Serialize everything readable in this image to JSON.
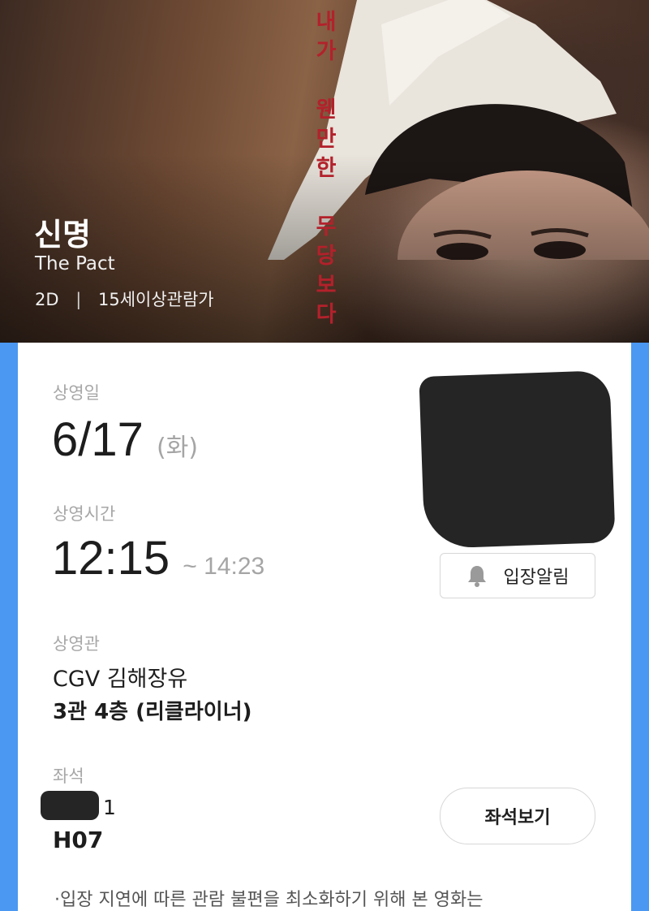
{
  "movie": {
    "title": "신명",
    "subtitle": "The Pact",
    "format": "2D",
    "separator": "|",
    "rating": "15세이상관람가",
    "poster_text": [
      "내",
      "가",
      "",
      "웬",
      "만",
      "한",
      "",
      "무",
      "당",
      "보",
      "다"
    ]
  },
  "ticket": {
    "date_label": "상영일",
    "date": "6/17",
    "weekday": "(화)",
    "time_label": "상영시간",
    "start_time": "12:15",
    "end_time": "~ 14:23",
    "theater_label": "상영관",
    "theater_name": "CGV 김해장유",
    "hall": "3관 4층 (리클라이너)",
    "seat_label": "좌석",
    "seat_suffix": "1",
    "seat_code": "H07",
    "notice": "·입장 지연에 따른 관람 불편을 최소화하기 위해 본 영화는"
  },
  "buttons": {
    "entry_alert": "입장알림",
    "view_seat": "좌석보기"
  },
  "icons": {
    "bell": "bell-icon"
  },
  "colors": {
    "side_background": "#4a98f2",
    "poster_text": "#b3212b",
    "redaction": "#252525"
  }
}
